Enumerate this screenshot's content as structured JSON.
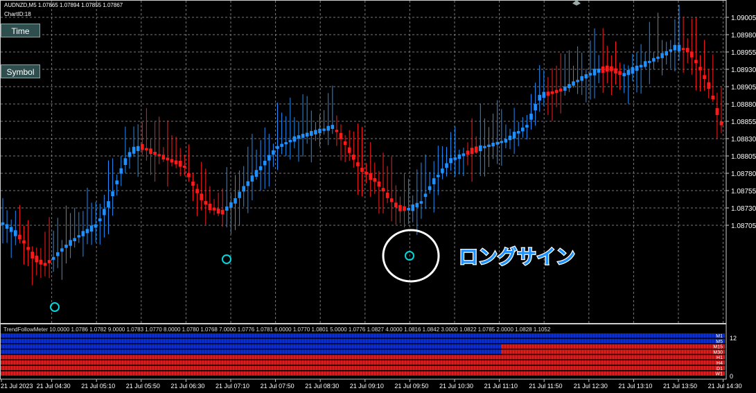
{
  "header": {
    "symbol_line": "AUDNZD,M5  1.07865 1.07894 1.07855 1.07867",
    "chart_id": "ChartID:18"
  },
  "buttons": {
    "time": "Time",
    "symbol": "Symbol"
  },
  "annotation": {
    "text": "ロングサイン"
  },
  "price_axis": [
    "1.09005",
    "1.08980",
    "1.08955",
    "1.08930",
    "1.08905",
    "1.08880",
    "1.08855",
    "1.08830",
    "1.08805",
    "1.08780",
    "1.08755",
    "1.08730",
    "1.08705"
  ],
  "time_axis": [
    "21 Jul 2023",
    "21 Jul 04:30",
    "21 Jul 05:10",
    "21 Jul 05:50",
    "21 Jul 06:30",
    "21 Jul 07:10",
    "21 Jul 07:50",
    "21 Jul 08:30",
    "21 Jul 09:10",
    "21 Jul 09:50",
    "21 Jul 10:30",
    "21 Jul 11:10",
    "21 Jul 11:50",
    "21 Jul 12:30",
    "21 Jul 13:10",
    "21 Jul 13:50",
    "21 Jul 14:30"
  ],
  "indicator": {
    "title": "TrendFollowMeter 10.0000 1.0786 1.0782 9.0000 1.0783 1.0770 8.0000 1.0780 1.0768 7.0000 1.0776 1.0781 6.0000 1.0770 1.0801 5.0000 1.0776 1.0827 4.0000 1.0816 1.0842 3.0000 1.0822 1.0785 2.0000 1.0828 1.1052",
    "scale_max": "12",
    "scale_min": "0",
    "timeframes": [
      "M1",
      "M5",
      "M15",
      "M30",
      "H1",
      "H4",
      "D1",
      "W1"
    ]
  },
  "colors": {
    "bull": "#1e90ff",
    "bear": "#ff1a1a",
    "grid": "#7a7a7a",
    "circle": "#00d8e0",
    "annotation": "#1e90ff"
  }
}
